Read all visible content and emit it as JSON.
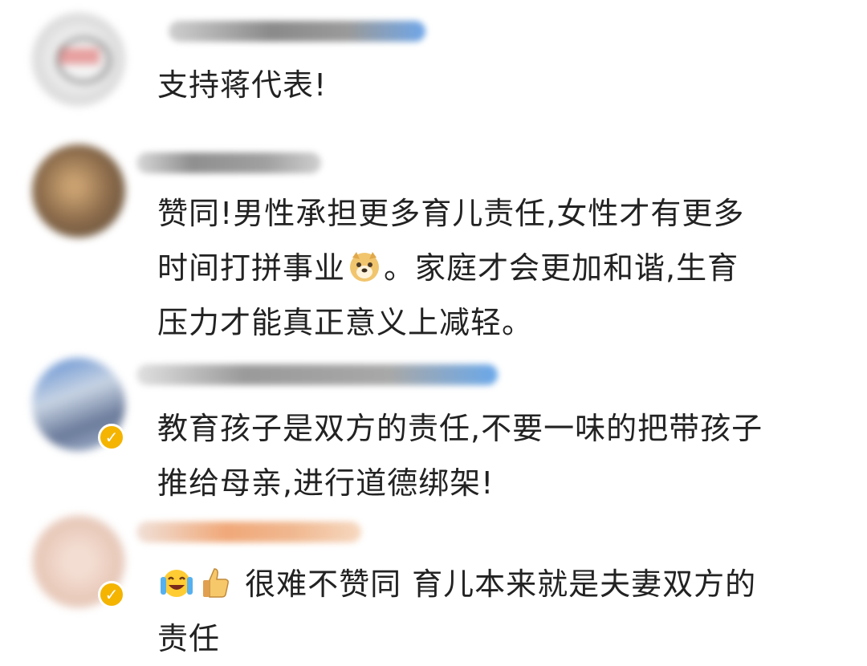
{
  "comments": [
    {
      "text": "支持蒋代表!",
      "verified": false
    },
    {
      "line1": "赞同!男性承担更多育儿责任,女性才有更多",
      "line2a": "时间打拼事业",
      "line2b": "。家庭才会更加和谐,生育",
      "line3": "压力才能真正意义上减轻。",
      "verified": false,
      "emoji": "doge-icon"
    },
    {
      "line1": "教育孩子是双方的责任,不要一味的把带孩子",
      "line2": "推给母亲,进行道德绑架!",
      "verified": true
    },
    {
      "line1": "很难不赞同 育儿本来就是夫妻双方的",
      "line2": "责任",
      "verified": true,
      "emojis": [
        "laugh-cry-icon",
        "thumbs-up-icon"
      ]
    }
  ],
  "verified_mark": "✓"
}
